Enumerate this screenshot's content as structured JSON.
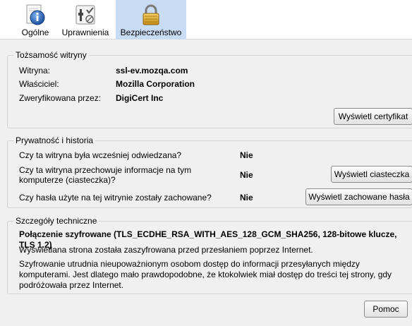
{
  "tabs": [
    {
      "label": "Ogólne"
    },
    {
      "label": "Uprawnienia"
    },
    {
      "label": "Bezpieczeństwo"
    }
  ],
  "identity": {
    "legend": "Tożsamość witryny",
    "site_label": "Witryna:",
    "site_value": "ssl-ev.mozqa.com",
    "owner_label": "Właściciel:",
    "owner_value": "Mozilla Corporation",
    "verified_label": "Zweryfikowana przez:",
    "verified_value": "DigiCert Inc",
    "cert_button": "Wyświetl certyfikat"
  },
  "privacy": {
    "legend": "Prywatność i historia",
    "q1": "Czy ta witryna była wcześniej odwiedzana?",
    "a1": "Nie",
    "q2": "Czy ta witryna przechowuje informacje na tym komputerze (ciasteczka)?",
    "a2": "Nie",
    "cookies_button": "Wyświetl ciasteczka",
    "q3": "Czy hasła użyte na tej witrynie zostały zachowane?",
    "a3": "Nie",
    "passwords_button": "Wyświetl zachowane hasła"
  },
  "tech": {
    "legend": "Szczegóły techniczne",
    "connection": "Połączenie szyfrowane (TLS_ECDHE_RSA_WITH_AES_128_GCM_SHA256, 128-bitowe klucze, TLS 1.2)",
    "line1": "Wyświetlana strona została zaszyfrowana przed przesłaniem poprzez Internet.",
    "line2": "Szyfrowanie utrudnia nieupoważnionym osobom dostęp do informacji przesyłanych między komputerami. Jest dlatego mało prawdopodobne, że ktokolwiek miał dostęp do treści tej strony, gdy podróżowała przez Internet."
  },
  "help_button": "Pomoc",
  "colors": {
    "active_tab": "#c8dcf3",
    "background": "#f0f0f0"
  },
  "icons": [
    "info-icon",
    "permissions-icon",
    "lock-icon"
  ]
}
